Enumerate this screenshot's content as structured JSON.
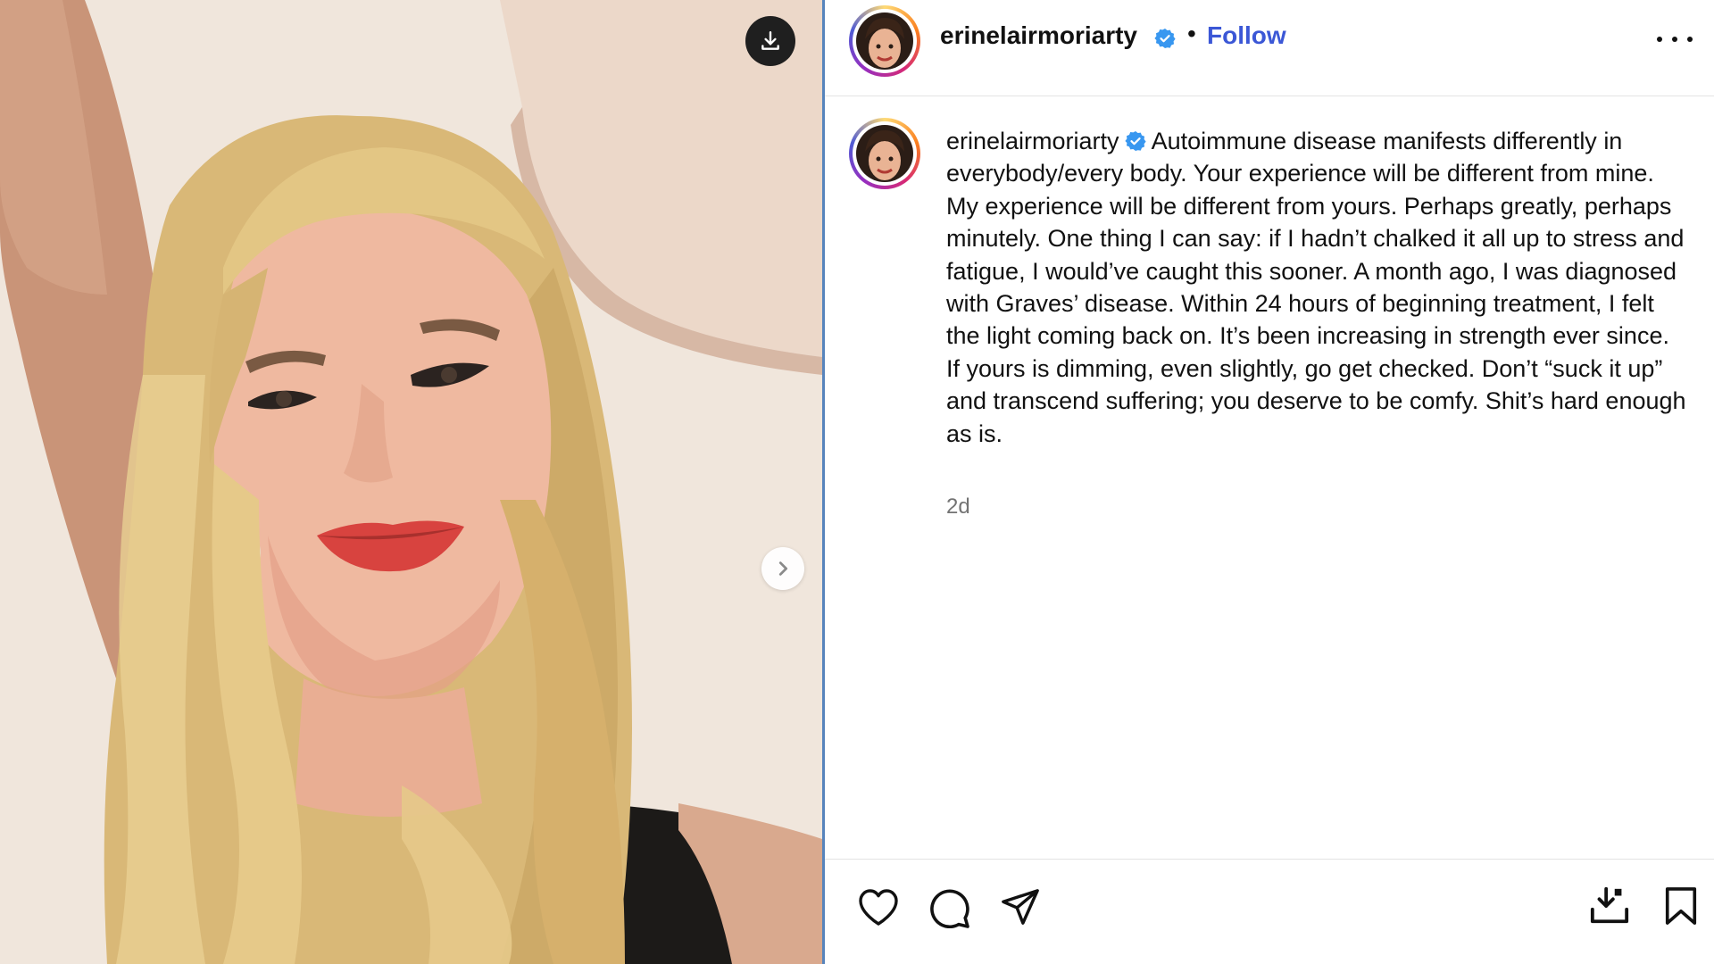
{
  "post": {
    "username": "erinelairmoriarty",
    "separator": "•",
    "follow_label": "Follow",
    "caption": "Autoimmune disease manifests differently in everybody/every body. Your experience will be different from mine. My experience will be different from yours. Perhaps greatly, perhaps minutely. One thing I can say: if I hadn’t chalked it all up to stress and fatigue, I would’ve caught this sooner. A month ago, I was diagnosed with Graves’ disease. Within 24 hours of beginning treatment, I felt the light coming back on. It’s been increasing in strength ever since. If yours is dimming, even slightly, go get checked. Don’t “suck it up” and transcend suffering; you deserve to be comfy. Shit’s hard enough as is.",
    "timestamp": "2d",
    "verified": true
  },
  "icons": {
    "download_overlay": "download-icon",
    "next": "chevron-right-icon",
    "more": "more-horizontal-icon",
    "verified": "verified-badge-icon",
    "like": "heart-icon",
    "comment": "comment-icon",
    "share": "paper-plane-icon",
    "save_download": "download-tray-icon",
    "bookmark": "bookmark-icon"
  },
  "colors": {
    "follow": "#3b57d6",
    "verified": "#3897f0",
    "muted_text": "#737373",
    "divider": "#e3e3e3"
  }
}
